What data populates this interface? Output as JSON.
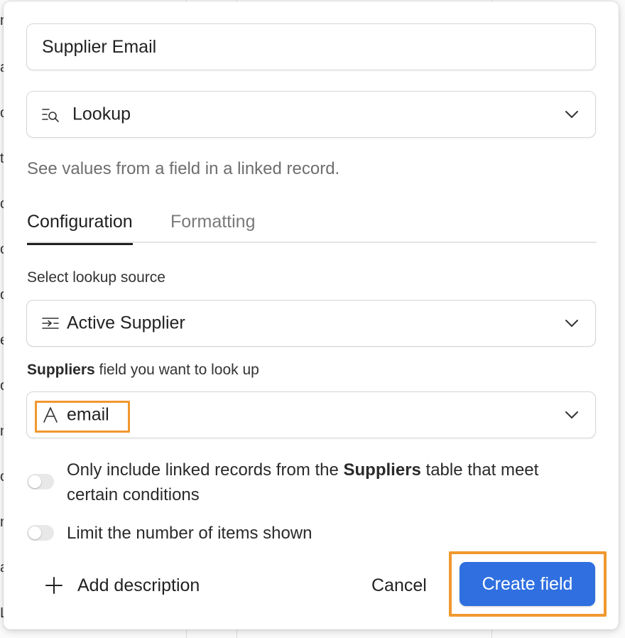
{
  "background": {
    "row_letters": [
      "n",
      "a",
      "o",
      "t",
      "c",
      "o",
      "o",
      "e",
      "o",
      "n",
      "o",
      "n",
      "a",
      "L"
    ]
  },
  "dialog": {
    "field_name_value": "Supplier Email",
    "field_type": {
      "icon": "lookup-icon",
      "label": "Lookup"
    },
    "type_description": "See values from a field in a linked record.",
    "tabs": [
      {
        "label": "Configuration",
        "active": true
      },
      {
        "label": "Formatting",
        "active": false
      }
    ],
    "lookup_source": {
      "label": "Select lookup source",
      "icon": "linked-record-icon",
      "value": "Active Supplier"
    },
    "lookup_field": {
      "label_bold": "Suppliers",
      "label_rest": " field you want to look up",
      "icon": "text-field-icon",
      "value": "email"
    },
    "options": [
      {
        "text_before": "Only include linked records from the ",
        "text_bold": "Suppliers",
        "text_after": " table that meet certain conditions",
        "enabled": false
      },
      {
        "text": "Limit the number of items shown",
        "enabled": false
      }
    ],
    "footer": {
      "add_description_label": "Add description",
      "cancel_label": "Cancel",
      "create_label": "Create field"
    },
    "colors": {
      "primary_button": "#2f6fe0",
      "highlight": "#f0982e"
    }
  }
}
